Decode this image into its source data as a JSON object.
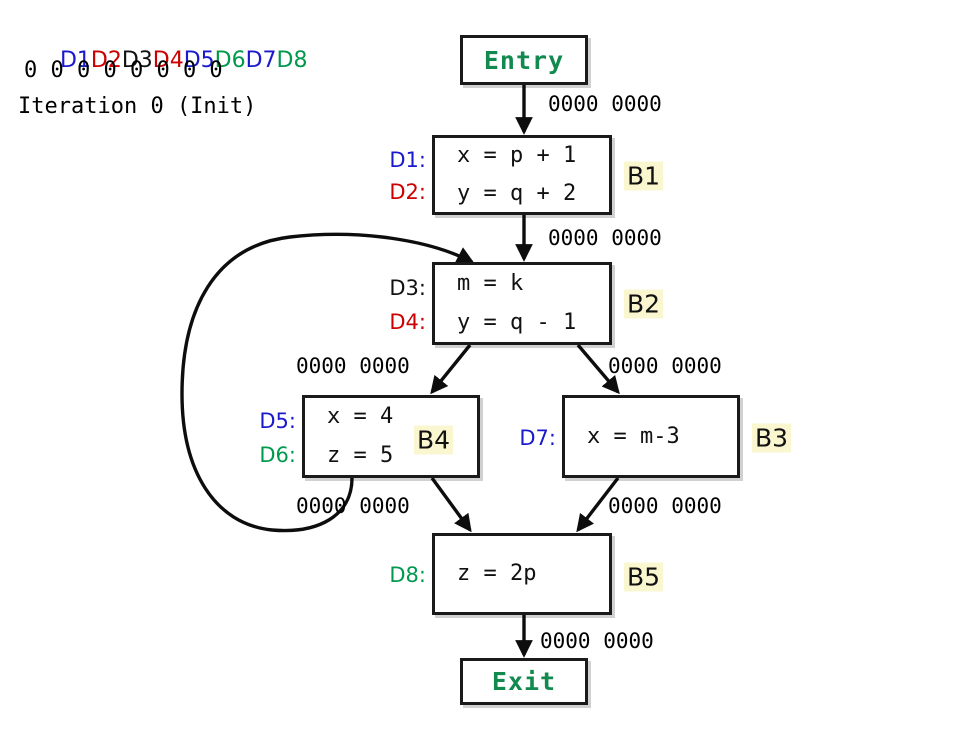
{
  "legend": {
    "defs": [
      {
        "label": "D1",
        "color": "#1A1ACC"
      },
      {
        "label": "D2",
        "color": "#CC0000"
      },
      {
        "label": "D3",
        "color": "#111111"
      },
      {
        "label": "D4",
        "color": "#CC0000"
      },
      {
        "label": "D5",
        "color": "#1A1ACC"
      },
      {
        "label": "D6",
        "color": "#00994D"
      },
      {
        "label": "D7",
        "color": "#1A1ACC"
      },
      {
        "label": "D8",
        "color": "#00994D"
      }
    ],
    "bits": "0 0 0 0 0 0 0 0",
    "caption": "Iteration 0 (Init)"
  },
  "colors": {
    "blue": "#1A1ACC",
    "red": "#CC0000",
    "green": "#00994D",
    "black": "#111111",
    "terminal_text": "#128A4F",
    "chip_bg": "#FAF6D0",
    "border": "#1A1A1A"
  },
  "nodes": {
    "entry": {
      "label": "Entry"
    },
    "exit": {
      "label": "Exit"
    },
    "b1": {
      "name": "B1",
      "stmts": [
        "x = p + 1",
        "y = q + 2"
      ],
      "defs": [
        {
          "label": "D1:",
          "color": "#1A1ACC"
        },
        {
          "label": "D2:",
          "color": "#CC0000"
        }
      ]
    },
    "b2": {
      "name": "B2",
      "stmts": [
        "m = k",
        "y = q - 1"
      ],
      "defs": [
        {
          "label": "D3:",
          "color": "#111111"
        },
        {
          "label": "D4:",
          "color": "#CC0000"
        }
      ]
    },
    "b4": {
      "name": "B4",
      "stmts": [
        "x = 4",
        "z = 5"
      ],
      "defs": [
        {
          "label": "D5:",
          "color": "#1A1ACC"
        },
        {
          "label": "D6:",
          "color": "#00994D"
        }
      ]
    },
    "b3": {
      "name": "B3",
      "stmts": [
        "x = m-3"
      ],
      "defs": [
        {
          "label": "D7:",
          "color": "#1A1ACC"
        }
      ]
    },
    "b5": {
      "name": "B5",
      "stmts": [
        "z = 2p"
      ],
      "defs": [
        {
          "label": "D8:",
          "color": "#00994D"
        }
      ]
    }
  },
  "edge_labels": {
    "entry_b1": "0000 0000",
    "b1_b2": "0000 0000",
    "b2_b4": "0000 0000",
    "b2_b3": "0000 0000",
    "b4_b5": "0000 0000",
    "b3_b5": "0000 0000",
    "b5_exit": "0000 0000"
  }
}
